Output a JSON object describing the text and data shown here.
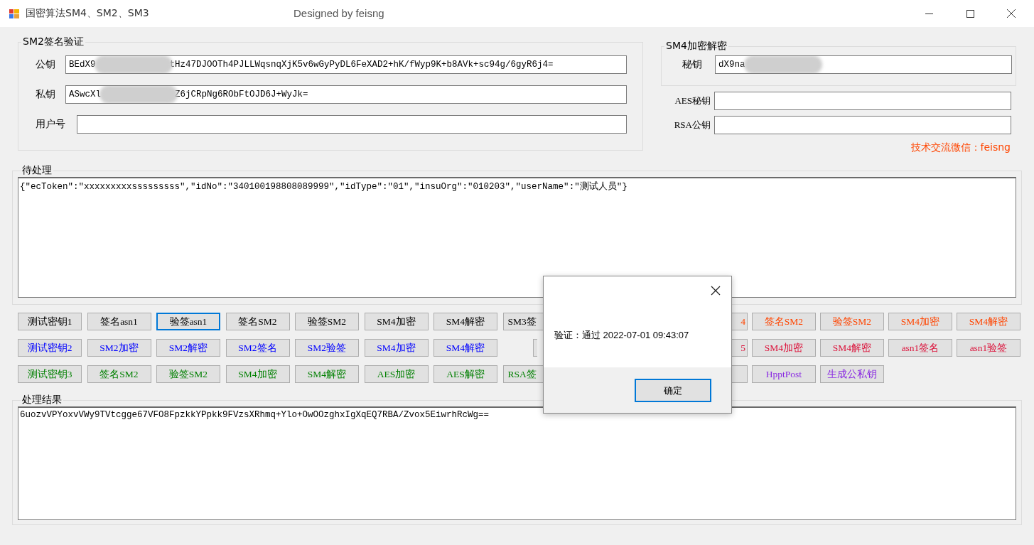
{
  "window": {
    "title": "国密算法SM4、SM2、SM3",
    "subtitle": "Designed by feisng"
  },
  "sm2_group": {
    "title": "SM2签名验证",
    "fields": [
      {
        "label": "公钥",
        "value_start": "BEdX9",
        "value_end": "tHz47DJOOTh4PJLLWqsnqXjK5v6wGyPyDL6FeXAD2+hK/fWyp9K+b8AVk+sc94g/6gyR6j4=",
        "redacted": true
      },
      {
        "label": "私钥",
        "value_start": "ASwcXl",
        "value_end": "Z6jCRpNg6RObFtOJD6J+WyJk=",
        "redacted": true
      },
      {
        "label": "用户号"
      }
    ]
  },
  "sm4_group": {
    "title": "SM4加密解密",
    "field": {
      "label": "秘钥",
      "value_start": "dX9na",
      "redacted": true
    }
  },
  "extra_fields": [
    {
      "label": "AES秘钥"
    },
    {
      "label": "RSA公钥"
    }
  ],
  "contact": "技术交流微信：feisng",
  "input_group": {
    "title": "待处理",
    "value": "{\"ecToken\":\"xxxxxxxxxsssssssss\",\"idNo\":\"340100198808089999\",\"idType\":\"01\",\"insuOrg\":\"010203\",\"userName\":\"测试人员\"}"
  },
  "button_rows": [
    {
      "left": {
        "color": "#000000",
        "buttons": [
          {
            "label": "测试密钥1",
            "kind": "full",
            "focused": false
          },
          {
            "label": "签名asn1",
            "kind": "full",
            "focused": false
          },
          {
            "label": "验签asn1",
            "kind": "full",
            "focused": true
          },
          {
            "label": "签名SM2",
            "kind": "full",
            "focused": false
          },
          {
            "label": "验签SM2",
            "kind": "full",
            "focused": false
          },
          {
            "label": "SM4加密",
            "kind": "full",
            "focused": false
          },
          {
            "label": "SM4解密",
            "kind": "full",
            "focused": false
          },
          {
            "label": "SM3签",
            "kind": "cut",
            "focused": false
          }
        ]
      },
      "right": {
        "color": "#ff4500",
        "buttons": [
          {
            "label": "4",
            "kind": "cut",
            "focused": false
          },
          {
            "label": "签名SM2",
            "kind": "full",
            "focused": false
          },
          {
            "label": "验签SM2",
            "kind": "full",
            "focused": false
          },
          {
            "label": "SM4加密",
            "kind": "full",
            "focused": false
          },
          {
            "label": "SM4解密",
            "kind": "full",
            "focused": false
          }
        ]
      }
    },
    {
      "left": {
        "color": "#0000ff",
        "buttons": [
          {
            "label": "测试密钥2",
            "kind": "full",
            "focused": false
          },
          {
            "label": "SM2加密",
            "kind": "full",
            "focused": false
          },
          {
            "label": "SM2解密",
            "kind": "full",
            "focused": false
          },
          {
            "label": "SM2签名",
            "kind": "full",
            "focused": false
          },
          {
            "label": "SM2验签",
            "kind": "full",
            "focused": false
          },
          {
            "label": "SM4加密",
            "kind": "full",
            "focused": false
          },
          {
            "label": "SM4解密",
            "kind": "full",
            "focused": false
          },
          {
            "kind": "sliver",
            "focused": false
          }
        ]
      },
      "right": {
        "color": "#dc143c",
        "buttons": [
          {
            "label": "5",
            "kind": "cut",
            "focused": false
          },
          {
            "label": "SM4加密",
            "kind": "full",
            "focused": false
          },
          {
            "label": "SM4解密",
            "kind": "full",
            "focused": false
          },
          {
            "label": "asn1签名",
            "kind": "full",
            "focused": false
          },
          {
            "label": "asn1验签",
            "kind": "full",
            "focused": false
          }
        ]
      }
    },
    {
      "left": {
        "color": "#008000",
        "buttons": [
          {
            "label": "测试密钥3",
            "kind": "full",
            "focused": false
          },
          {
            "label": "签名SM2",
            "kind": "full",
            "focused": false
          },
          {
            "label": "验签SM2",
            "kind": "full",
            "focused": false
          },
          {
            "label": "SM4加密",
            "kind": "full",
            "focused": false
          },
          {
            "label": "SM4解密",
            "kind": "full",
            "focused": false
          },
          {
            "label": "AES加密",
            "kind": "full",
            "focused": false
          },
          {
            "label": "AES解密",
            "kind": "full",
            "focused": false
          },
          {
            "label": "RSA签",
            "kind": "cut",
            "focused": false
          }
        ]
      },
      "right": {
        "color": "#8a2be2",
        "buttons": [
          {
            "kind": "cut",
            "focused": false
          },
          {
            "label": "HpptPost",
            "kind": "full",
            "focused": false
          },
          {
            "label": "生成公私钥",
            "kind": "full",
            "focused": false
          }
        ]
      }
    }
  ],
  "result_group": {
    "title": "处理结果",
    "value": "6uozvVPYoxvVWy9TVtcgge67VFO8FpzkkYPpkk9FVzsXRhmq+Ylo+OwOOzghxIgXqEQ7RBA/Zvox5EiwrhRcWg=="
  },
  "dialog": {
    "message": "验证：通过 2022-07-01 09:43:07",
    "ok": "确定"
  }
}
